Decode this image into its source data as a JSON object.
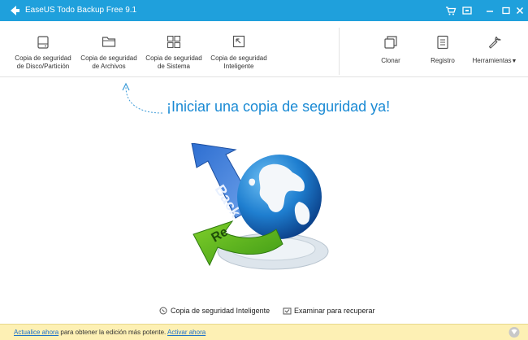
{
  "app": {
    "title": "EaseUS Todo Backup Free 9.1"
  },
  "toolbar": {
    "tools": [
      {
        "line1": "Copia de seguridad",
        "line2": "de Disco/Partición"
      },
      {
        "line1": "Copia de seguridad",
        "line2": "de Archivos"
      },
      {
        "line1": "Copia de seguridad",
        "line2": "de Sistema"
      },
      {
        "line1": "Copia de seguridad",
        "line2": "Inteligente"
      }
    ],
    "right": [
      {
        "label": "Clonar"
      },
      {
        "label": "Registro"
      },
      {
        "label": "Herramientas"
      }
    ]
  },
  "main": {
    "headline": "¡Iniciar una copia de seguridad ya!",
    "links": [
      {
        "label": "Copia de seguridad Inteligente"
      },
      {
        "label": "Examinar para recuperar"
      }
    ],
    "graphic_words": {
      "backup": "Back",
      "restore": "Re"
    }
  },
  "footer": {
    "upgrade": "Actualice ahora",
    "middle": "para obtener la edición más potente.",
    "activate": "Activar ahora"
  },
  "colors": {
    "titlebar": "#1fa0dc",
    "accent": "#1a8ad4",
    "footer": "#fdf0b4"
  }
}
